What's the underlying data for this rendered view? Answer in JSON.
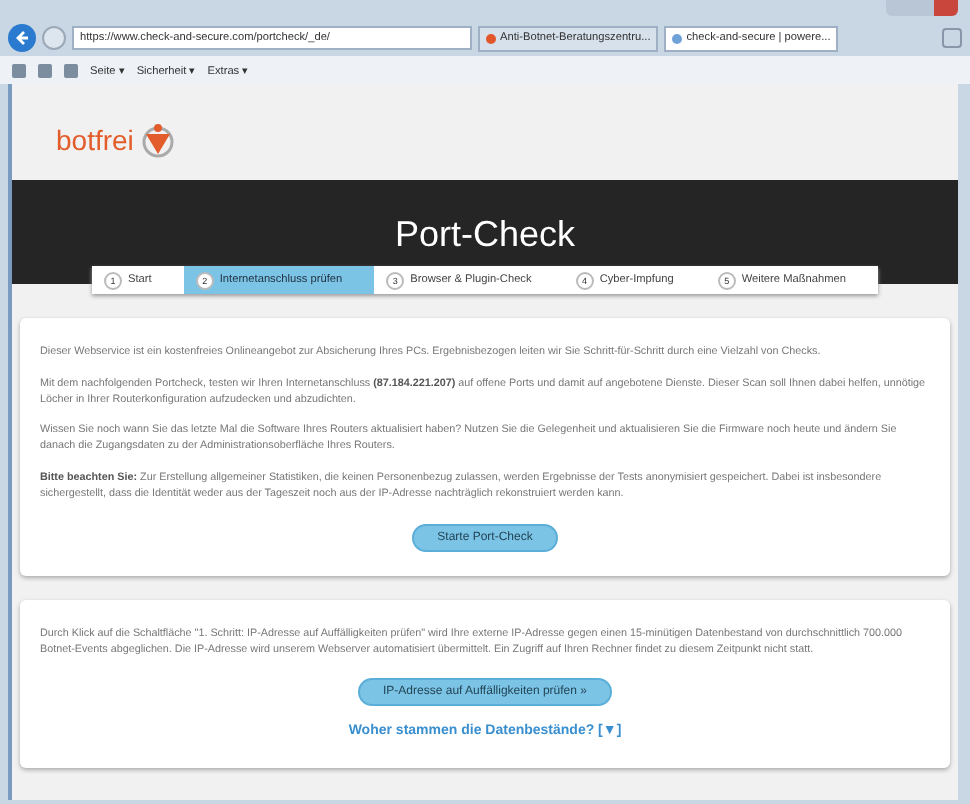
{
  "browser": {
    "address": "https://www.check-and-secure.com/portcheck/_de/",
    "tabs": [
      {
        "title": "Anti-Botnet-Beratungszentru...",
        "selected": false
      },
      {
        "title": "check-and-secure | powere...",
        "selected": true
      }
    ],
    "toolbar": [
      "Seite ▾",
      "Sicherheit ▾",
      "Extras ▾"
    ]
  },
  "logo": "botfrei",
  "banner": {
    "title": "Port-Check"
  },
  "steps": [
    {
      "number": "1",
      "label": "Start",
      "selected": false
    },
    {
      "number": "2",
      "label": "Internetanschluss prüfen",
      "selected": true
    },
    {
      "number": "3",
      "label": "Browser & Plugin-Check",
      "selected": false
    },
    {
      "number": "4",
      "label": "Cyber-Impfung",
      "selected": false
    },
    {
      "number": "5",
      "label": "Weitere Maßnahmen",
      "selected": false
    }
  ],
  "intro": {
    "paragraphs": [
      "Dieser Webservice ist ein kostenfreies Onlineangebot zur Absicherung Ihres PCs. Ergebnisbezogen leiten wir Sie Schritt-für-Schritt durch eine Vielzahl von Checks.",
      "Mit dem nachfolgenden Portcheck, testen wir Ihren Internetanschluss **(87.184.221.207)** auf offene Ports und damit auf angebotene Dienste. Dieser Scan soll Ihnen dabei helfen, unnötige Löcher in Ihrer Routerkonfiguration aufzudecken und abzudichten.",
      "Wissen Sie noch wann Sie das letzte Mal die Software Ihres Routers aktualisiert haben? Nutzen Sie die Gelegenheit und aktualisieren Sie die Firmware noch heute und ändern Sie danach die Zugangsdaten zu der Administrationsoberfläche Ihres Routers.",
      "**Bitte beachten Sie:** Zur Erstellung allgemeiner Statistiken, die keinen Personenbezug zulassen, werden Ergebnisse der Tests anonymisiert gespeichert. Dabei ist insbesondere sichergestellt, dass die Identität weder aus der Tageszeit noch aus der IP-Adresse nachträglich rekonstruiert werden kann."
    ],
    "button": "Starte Port-Check"
  },
  "botnet": {
    "paragraph": "Durch Klick auf die Schaltfläche \"1. Schritt: IP-Adresse auf Auffälligkeiten prüfen\" wird Ihre externe IP-Adresse gegen einen 15-minütigen Datenbestand von durchschnittlich 700.000 Botnet-Events abgeglichen. Die IP-Adresse wird unserem Webserver automatisiert übermittelt. Ein Zugriff auf Ihren Rechner findet zu diesem Zeitpunkt nicht statt.",
    "button": "IP-Adresse auf Auffälligkeiten prüfen »",
    "link": "Woher stammen die Datenbestände? [▼]"
  }
}
